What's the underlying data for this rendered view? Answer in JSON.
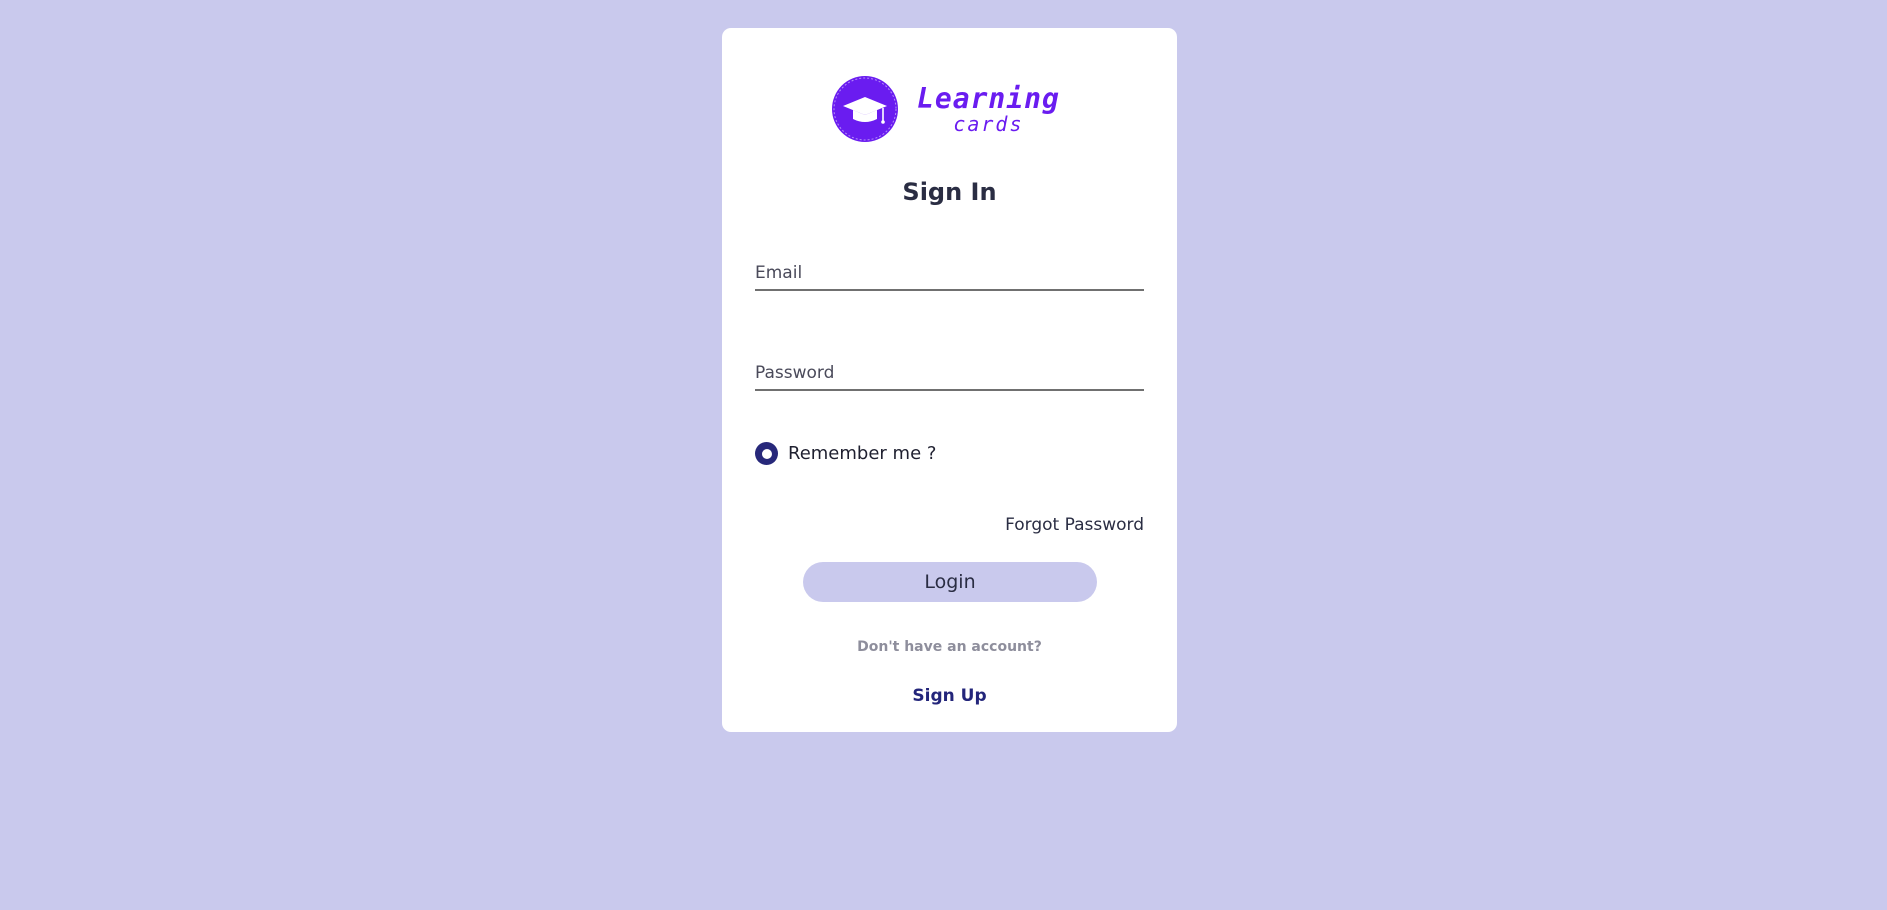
{
  "brand": {
    "title_line1": "Learning",
    "title_line2": "cards",
    "logo_icon": "graduation-cap-icon",
    "logo_color": "#6a1cf0"
  },
  "form": {
    "title": "Sign In",
    "email_placeholder": "Email",
    "email_value": "",
    "password_placeholder": "Password",
    "password_value": "",
    "remember_label": "Remember me ?",
    "remember_checked": true,
    "forgot_label": "Forgot Password",
    "login_label": "Login",
    "no_account_text": "Don't have an account?",
    "signup_label": "Sign Up"
  },
  "colors": {
    "page_background": "#c9c9ed",
    "card_background": "#ffffff",
    "accent_dark": "#27287a",
    "button_background": "#c9c9ed"
  }
}
